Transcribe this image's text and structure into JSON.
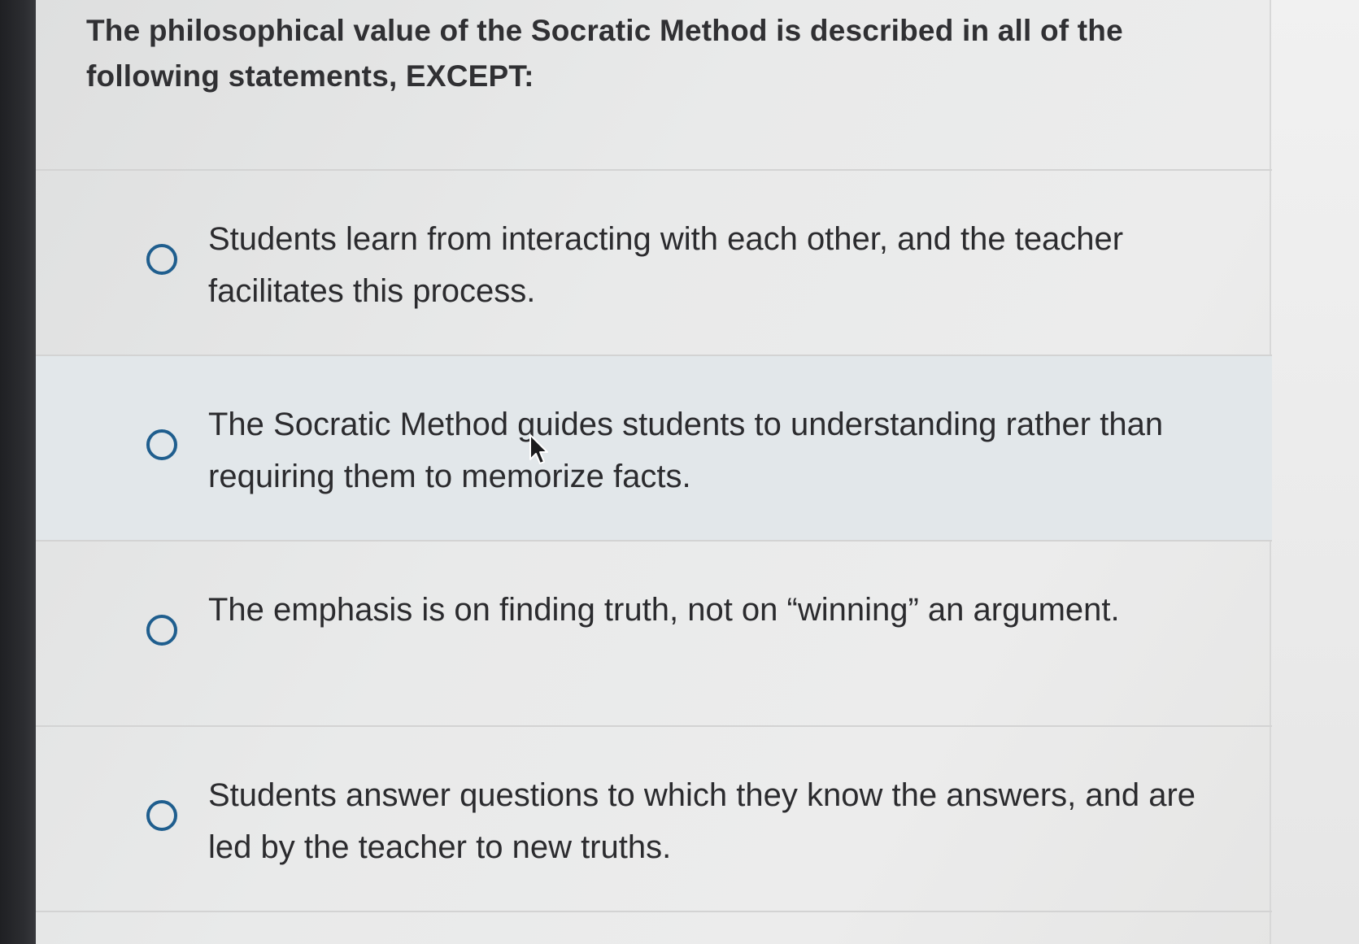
{
  "question": {
    "text": "The philosophical value of the Socratic Method is described in all of the following statements, EXCEPT:"
  },
  "options": [
    {
      "label": "Students learn from interacting with each other, and the teacher facilitates this process."
    },
    {
      "label": "The Socratic Method guides students to understanding rather than requiring them to memorize facts."
    },
    {
      "label": "The emphasis is on finding truth, not on “winning” an argument."
    },
    {
      "label": "Students answer questions to which they know the answers, and are led by the teacher to new truths."
    }
  ],
  "colors": {
    "radio_border": "#1f5e8e",
    "hover_background": "#e2e7ea"
  },
  "icons": {
    "radio": "radio-unselected-icon",
    "cursor": "mouse-pointer-icon"
  }
}
